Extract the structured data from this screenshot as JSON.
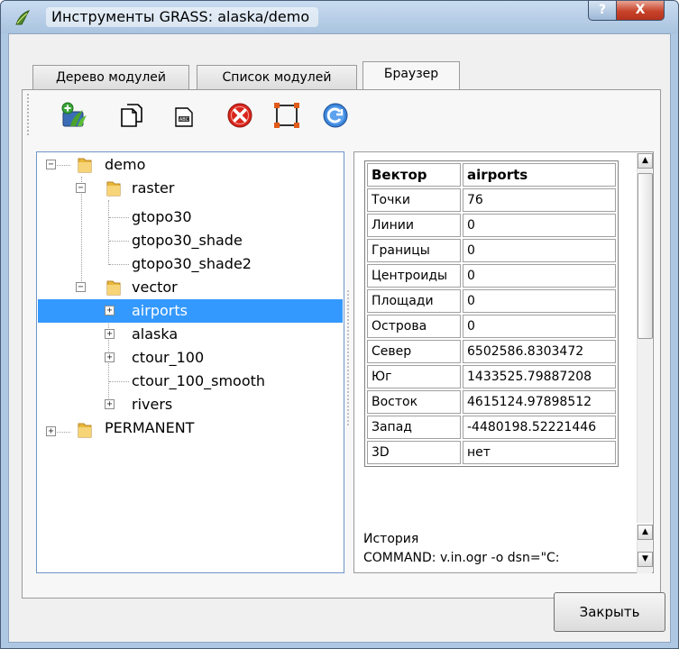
{
  "window": {
    "title": "Инструменты GRASS: alaska/demo",
    "help_glyph": "?",
    "close_glyph": "X"
  },
  "tabs": [
    {
      "label": "Дерево модулей",
      "active": false
    },
    {
      "label": "Список модулей",
      "active": false
    },
    {
      "label": "Браузер",
      "active": true
    }
  ],
  "toolbar": {
    "buttons": [
      {
        "icon": "add-layer-icon"
      },
      {
        "icon": "copy-icon"
      },
      {
        "icon": "rename-icon"
      },
      {
        "icon": "delete-icon"
      },
      {
        "icon": "set-region-icon"
      },
      {
        "icon": "refresh-icon"
      }
    ]
  },
  "tree": [
    {
      "label": "demo",
      "level": 0,
      "expander": "−",
      "folder": true
    },
    {
      "label": "raster",
      "level": 1,
      "expander": "−",
      "folder": true
    },
    {
      "label": "gtopo30",
      "level": 2,
      "expander": "",
      "folder": false
    },
    {
      "label": "gtopo30_shade",
      "level": 2,
      "expander": "",
      "folder": false
    },
    {
      "label": "gtopo30_shade2",
      "level": 2,
      "expander": "",
      "folder": false
    },
    {
      "label": "vector",
      "level": 1,
      "expander": "−",
      "folder": true
    },
    {
      "label": "airports",
      "level": 2,
      "expander": "+",
      "folder": false,
      "selected": true
    },
    {
      "label": "alaska",
      "level": 2,
      "expander": "+",
      "folder": false
    },
    {
      "label": "ctour_100",
      "level": 2,
      "expander": "+",
      "folder": false
    },
    {
      "label": "ctour_100_smooth",
      "level": 2,
      "expander": "",
      "folder": false
    },
    {
      "label": "rivers",
      "level": 2,
      "expander": "+",
      "folder": false
    },
    {
      "label": "PERMANENT",
      "level": 0,
      "expander": "+",
      "folder": true
    }
  ],
  "info": {
    "header": {
      "key": "Вектор",
      "value": "airports"
    },
    "rows": [
      {
        "key": "Точки",
        "value": "76"
      },
      {
        "key": "Линии",
        "value": "0"
      },
      {
        "key": "Границы",
        "value": "0"
      },
      {
        "key": "Центроиды",
        "value": "0"
      },
      {
        "key": "Площади",
        "value": "0"
      },
      {
        "key": "Острова",
        "value": "0"
      },
      {
        "key": "Север",
        "value": "6502586.8303472"
      },
      {
        "key": "Юг",
        "value": "1433525.79887208"
      },
      {
        "key": "Восток",
        "value": "4615124.97898512"
      },
      {
        "key": "Запад",
        "value": "-4480198.52221446"
      },
      {
        "key": "3D",
        "value": "нет"
      }
    ],
    "history_label": "История",
    "history_command": "COMMAND: v.in.ogr -o dsn=\"C:"
  },
  "footer": {
    "close_label": "Закрыть"
  }
}
